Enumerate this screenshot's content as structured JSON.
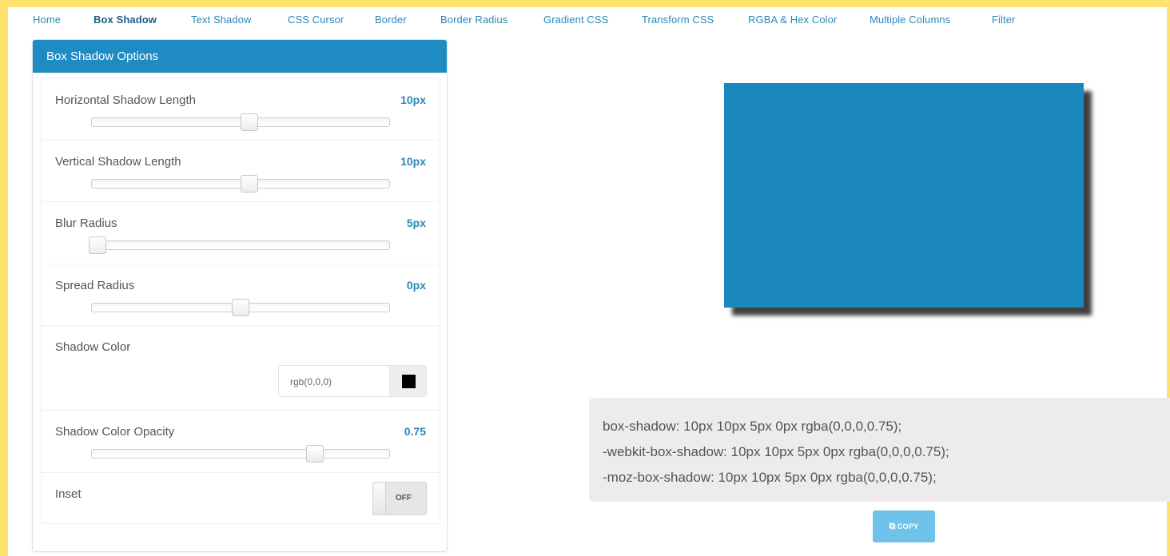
{
  "nav": {
    "items": [
      {
        "label": "Home",
        "active": false
      },
      {
        "label": "Box Shadow",
        "active": true
      },
      {
        "label": "Text Shadow",
        "active": false
      },
      {
        "label": "CSS Cursor",
        "active": false
      },
      {
        "label": "Border",
        "active": false
      },
      {
        "label": "Border Radius",
        "active": false
      },
      {
        "label": "Gradient CSS",
        "active": false
      },
      {
        "label": "Transform CSS",
        "active": false
      },
      {
        "label": "RGBA & Hex Color",
        "active": false
      },
      {
        "label": "Multiple Columns",
        "active": false
      },
      {
        "label": "Filter",
        "active": false
      }
    ]
  },
  "panel": {
    "title": "Box Shadow Options",
    "horizontal": {
      "label": "Horizontal Shadow Length",
      "value": "10px",
      "slider_fraction": 0.53
    },
    "vertical": {
      "label": "Vertical Shadow Length",
      "value": "10px",
      "slider_fraction": 0.53
    },
    "blur": {
      "label": "Blur Radius",
      "value": "5px",
      "slider_fraction": 0.02
    },
    "spread": {
      "label": "Spread Radius",
      "value": "0px",
      "slider_fraction": 0.5
    },
    "color": {
      "label": "Shadow Color",
      "value": "rgb(0,0,0)",
      "swatch": "#000000"
    },
    "opacity": {
      "label": "Shadow Color Opacity",
      "value": "0.75",
      "slider_fraction": 0.75
    },
    "inset": {
      "label": "Inset",
      "state": "OFF"
    }
  },
  "preview": {
    "color": "#1a87bc"
  },
  "code": {
    "lines": [
      "box-shadow: 10px 10px 5px 0px rgba(0,0,0,0.75);",
      "-webkit-box-shadow: 10px 10px 5px 0px rgba(0,0,0,0.75);",
      "-moz-box-shadow: 10px 10px 5px 0px rgba(0,0,0,0.75);"
    ]
  },
  "copy_button": {
    "label": "COPY",
    "icon": "copy-icon"
  },
  "colors": {
    "accent": "#1e8bc3",
    "background": "#fde36b",
    "value_text": "#2a8ab8"
  }
}
